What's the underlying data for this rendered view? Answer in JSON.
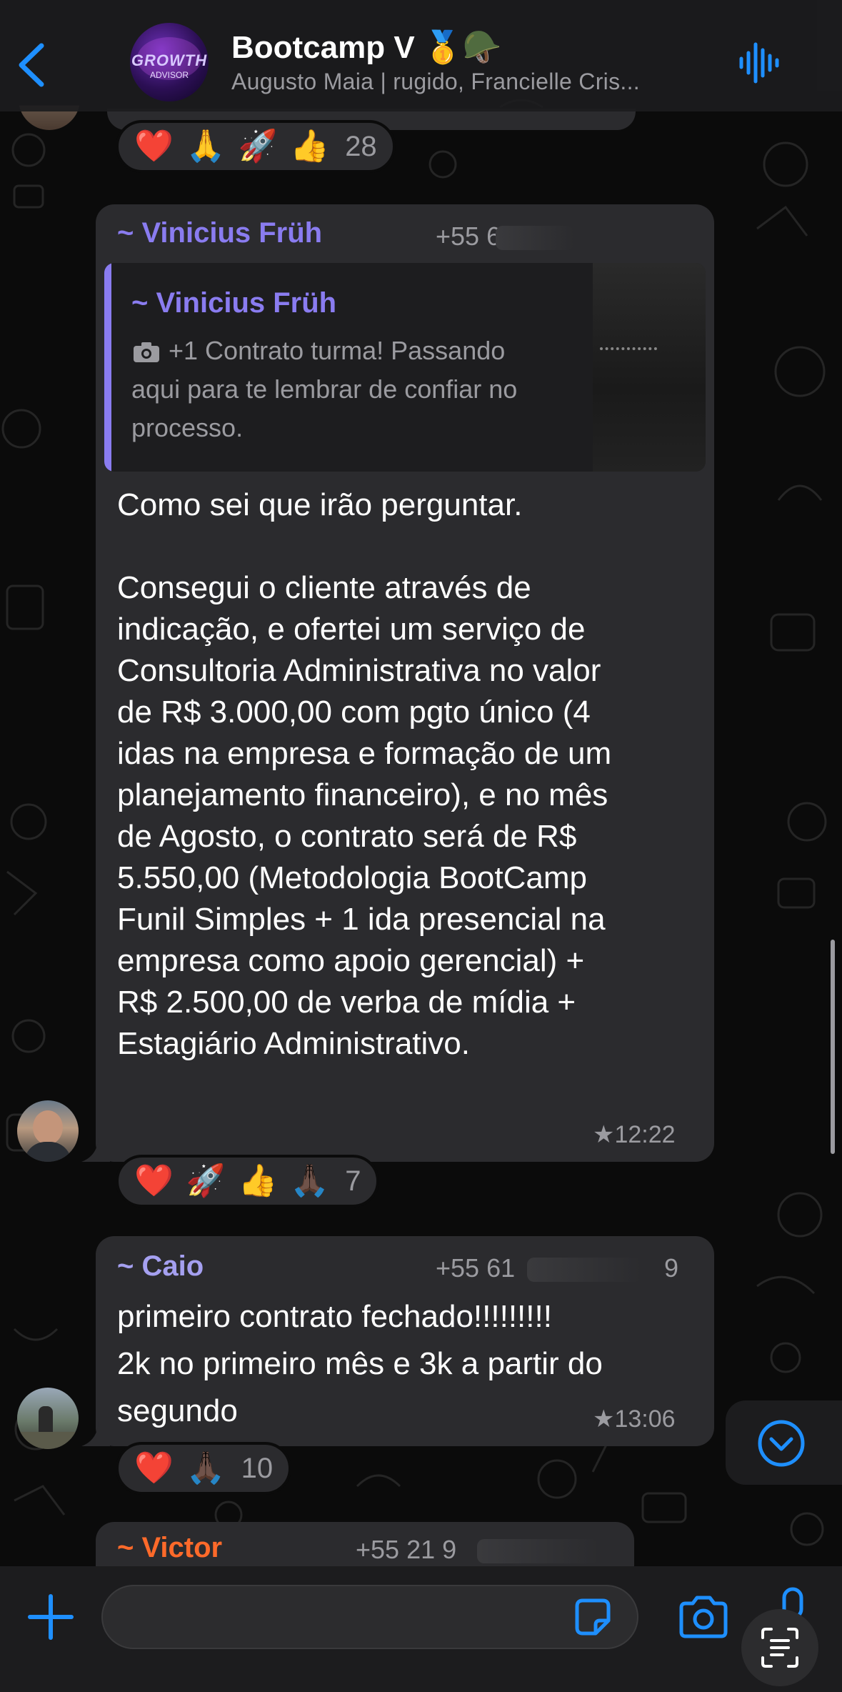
{
  "header": {
    "title": "Bootcamp V 🥇🪖",
    "subtitle": "Augusto Maia | rugido, Francielle Cris...",
    "group_avatar_line1": "GROWTH",
    "group_avatar_line2": "ADVISOR"
  },
  "reactions_top": {
    "emojis": [
      "❤️",
      "🙏",
      "🚀",
      "👍"
    ],
    "count": "28"
  },
  "message_vinicius": {
    "sender": "~ Vinicius Früh",
    "phone": "+55 6",
    "quote_sender": "~ Vinicius Früh",
    "quote_text": "+1 Contrato turma! Passando\naqui para te lembrar de confiar no\nprocesso.",
    "text": "Como sei que irão perguntar.\n\nConsegui o cliente através de\nindicação, e ofertei um serviço de\nConsultoria Administrativa no valor\nde R$ 3.000,00 com pgto único (4\nidas na empresa e formação de um\nplanejamento financeiro), e no mês\nde Agosto, o contrato será de R$\n5.550,00 (Metodologia BootCamp\nFunil Simples + 1 ida presencial na\nempresa como apoio gerencial) +\nR$ 2.500,00 de verba de mídia +\nEstagiário Administrativo.",
    "time": "★12:22",
    "reactions": {
      "emojis": [
        "❤️",
        "🚀",
        "👍",
        "🙏🏿"
      ],
      "count": "7"
    }
  },
  "message_caio": {
    "sender": "~ Caio",
    "phone": "+55 61",
    "phone_end": "9",
    "text": "primeiro contrato fechado!!!!!!!!!\n2k no primeiro mês e 3k a partir do\nsegundo",
    "time": "★13:06",
    "reactions": {
      "emojis": [
        "❤️",
        "🙏🏿"
      ],
      "count": "10"
    }
  },
  "message_victor": {
    "sender": "~ Victor",
    "phone": "+55 21 9"
  },
  "colors": {
    "accent_blue": "#1e8fff",
    "sender_vinicius": "#8a7cf0",
    "sender_caio": "#a5a0f0",
    "sender_victor": "#ff6a2a",
    "bubble": "#2b2b2e"
  },
  "icons": {
    "back": "chevron-left-icon",
    "audio": "audio-waveform-icon",
    "plus": "plus-icon",
    "sticker": "sticker-icon",
    "camera": "camera-icon",
    "scroll_down": "chevron-down-circle-icon",
    "live_text": "live-text-icon"
  }
}
